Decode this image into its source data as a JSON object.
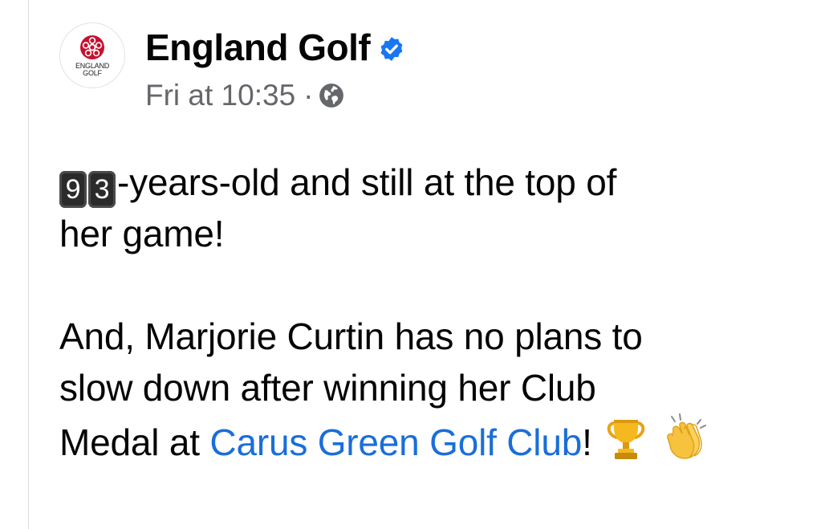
{
  "post": {
    "avatar_text": "ENGLAND\nGOLF",
    "author": "England Golf",
    "timestamp": "Fri at 10:35",
    "separator": "·",
    "verified_icon": "verified-badge-icon",
    "audience_icon": "globe-icon",
    "line1_digit1": "9",
    "line1_digit2": "3",
    "line1_rest": "-years-old and still at the top of",
    "line2": "her game!",
    "para2_line1": "And, Marjorie Curtin has no plans to",
    "para2_line2": "slow down after winning her Club",
    "para2_line3_prefix": "Medal at ",
    "link_text": "Carus Green Golf Club",
    "para2_line3_suffix": "!",
    "emoji_1": "trophy-icon",
    "emoji_2": "clapping-hands-icon"
  },
  "colors": {
    "link": "#1a6ed8",
    "verified": "#1877f2",
    "meta": "#65676b"
  }
}
